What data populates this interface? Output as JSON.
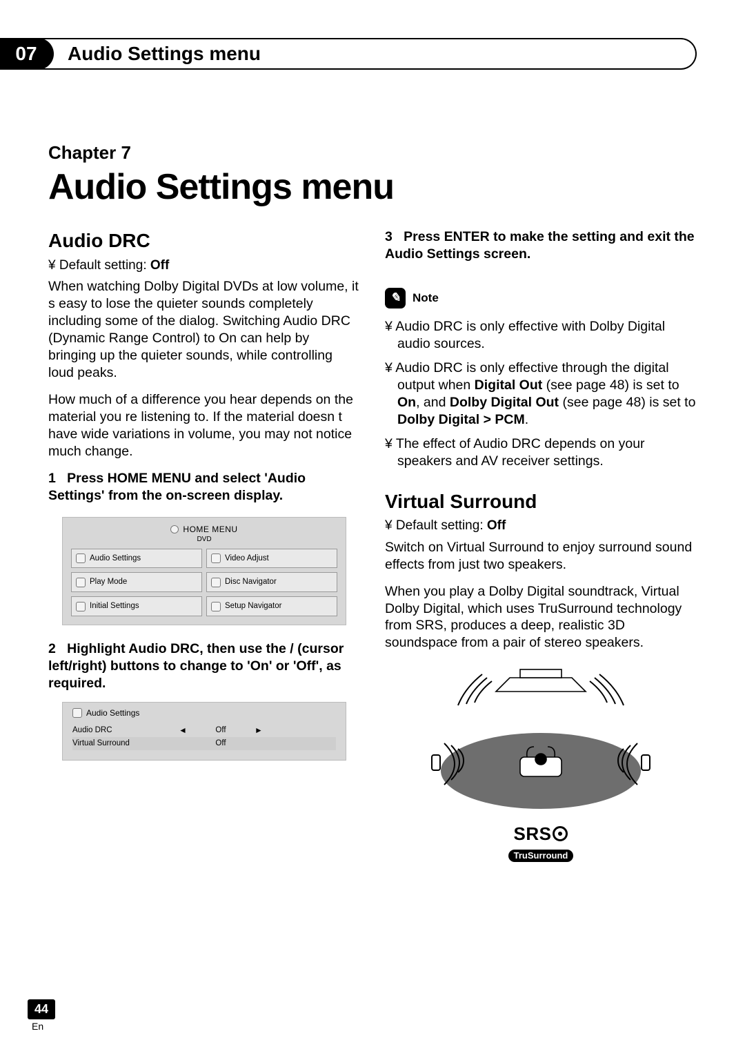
{
  "header": {
    "chapter_num": "07",
    "title": "Audio Settings menu"
  },
  "chapter": {
    "label": "Chapter 7",
    "title": "Audio Settings menu"
  },
  "audio_drc": {
    "heading": "Audio DRC",
    "default_setting_prefix": "Default setting: ",
    "default_setting_value": "Off",
    "para1": "When watching Dolby Digital DVDs at low volume, it s easy to lose the quieter sounds completely including some of the dialog. Switching Audio DRC (Dynamic Range Control) to On can help by bringing up the quieter sounds, while controlling loud peaks.",
    "para2": "How much of a difference you hear depends on the material you re listening to. If the material doesn t have wide variations in volume, you may not notice much change.",
    "step1_num": "1",
    "step1_text": "Press HOME MENU and select 'Audio Settings' from the on-screen display.",
    "step2_num": "2",
    "step2_text_a": "Highlight Audio DRC, then use the ",
    "step2_text_b": " /  (cursor left/right) buttons to change to 'On' or 'Off', as required.",
    "step3_num": "3",
    "step3_text": "Press ENTER to make the setting and exit the Audio Settings screen."
  },
  "home_menu": {
    "title": "HOME MENU",
    "subtitle": "DVD",
    "items": [
      "Audio Settings",
      "Video Adjust",
      "Play Mode",
      "Disc Navigator",
      "Initial Settings",
      "Setup Navigator"
    ]
  },
  "settings_screen": {
    "title": "Audio Settings",
    "rows": [
      {
        "label": "Audio DRC",
        "value": "Off",
        "active": true
      },
      {
        "label": "Virtual Surround",
        "value": "Off",
        "active": false
      }
    ]
  },
  "notes": {
    "label": "Note",
    "items": [
      {
        "parts": [
          {
            "t": "Audio DRC is only effective with Dolby Digital audio sources."
          }
        ]
      },
      {
        "parts": [
          {
            "t": "Audio DRC is only effective through the digital output when "
          },
          {
            "t": "Digital Out",
            "b": true
          },
          {
            "t": " (see page 48) is set to "
          },
          {
            "t": "On",
            "b": true
          },
          {
            "t": ", and "
          },
          {
            "t": "Dolby Digital Out",
            "b": true
          },
          {
            "t": " (see page 48) is set to "
          },
          {
            "t": "Dolby Digital > PCM",
            "b": true
          },
          {
            "t": "."
          }
        ]
      },
      {
        "parts": [
          {
            "t": "The effect of Audio DRC depends on your speakers and AV receiver settings."
          }
        ]
      }
    ]
  },
  "virtual_surround": {
    "heading": "Virtual Surround",
    "default_setting_prefix": "Default setting: ",
    "default_setting_value": "Off",
    "para1": "Switch on Virtual Surround to enjoy surround sound effects from just two speakers.",
    "para2": "When you play a Dolby Digital soundtrack, Virtual Dolby Digital, which uses TruSurround technology from SRS, produces a deep, realistic 3D soundspace from a pair of stereo speakers."
  },
  "srs": {
    "top": "SRS",
    "sub": "TruSurround"
  },
  "page": {
    "num": "44",
    "lang": "En"
  }
}
